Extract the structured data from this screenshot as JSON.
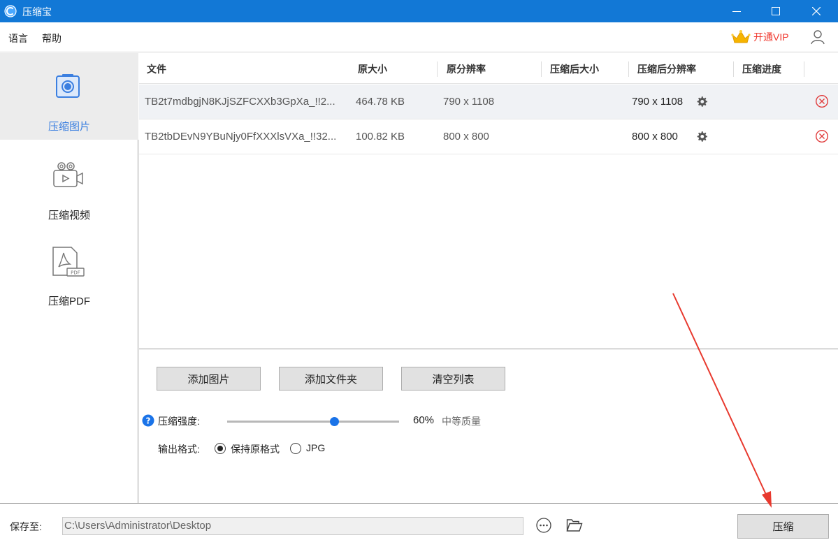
{
  "window": {
    "title": "压缩宝"
  },
  "menu": {
    "language": "语言",
    "help": "帮助",
    "vip_label": "开通VIP"
  },
  "sidebar": {
    "items": [
      {
        "label": "压缩图片",
        "icon": "image-compress-icon",
        "active": true
      },
      {
        "label": "压缩视频",
        "icon": "video-camera-icon",
        "active": false
      },
      {
        "label": "压缩PDF",
        "icon": "pdf-file-icon",
        "active": false
      }
    ]
  },
  "table": {
    "columns": [
      "文件",
      "原大小",
      "原分辨率",
      "压缩后大小",
      "压缩后分辨率",
      "压缩进度"
    ],
    "rows": [
      {
        "file": "TB2t7mdbgjN8KJjSZFCXXb3GpXa_!!2...",
        "size": "464.78 KB",
        "resolution": "790 x 1108",
        "compressed_size": "",
        "compressed_resolution": "790 x 1108",
        "progress": ""
      },
      {
        "file": "TB2tbDEvN9YBuNjy0FfXXXlsVXa_!!32...",
        "size": "100.82 KB",
        "resolution": "800 x 800",
        "compressed_size": "",
        "compressed_resolution": "800 x 800",
        "progress": ""
      }
    ]
  },
  "controls": {
    "add_image": "添加图片",
    "add_folder": "添加文件夹",
    "clear_list": "清空列表",
    "strength_label": "压缩强度:",
    "strength_value": 60,
    "strength_percent": "60%",
    "quality_label": "中等质量",
    "format_label": "输出格式:",
    "format_options": [
      "保持原格式",
      "JPG"
    ],
    "format_selected": "保持原格式"
  },
  "footer": {
    "save_label": "保存至:",
    "save_path": "C:\\Users\\Administrator\\Desktop",
    "compress_button": "压缩"
  },
  "colors": {
    "titlebar": "#1278d6",
    "accent": "#1a73e8",
    "vip": "#f0372d",
    "delete": "#e03a3a",
    "annotation_arrow": "#e8392e"
  }
}
